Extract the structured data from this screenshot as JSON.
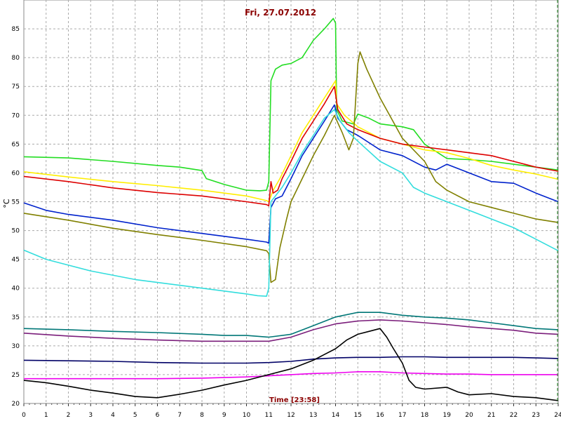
{
  "chart_data": {
    "type": "line",
    "title": "Fri, 27.07.2012",
    "xlabel": "Time [23:58]",
    "ylabel": "°C",
    "xlim": [
      0,
      24
    ],
    "ylim": [
      20,
      90
    ],
    "xticks": [
      0,
      1,
      2,
      3,
      4,
      5,
      6,
      7,
      8,
      9,
      10,
      11,
      12,
      13,
      14,
      15,
      16,
      17,
      18,
      19,
      20,
      21,
      22,
      23,
      24
    ],
    "yticks": [
      20,
      25,
      30,
      35,
      40,
      45,
      50,
      55,
      60,
      65,
      70,
      75,
      80,
      85
    ],
    "grid": true,
    "series": [
      {
        "color": "#22dd22",
        "points": [
          [
            0,
            62.8
          ],
          [
            2,
            62.6
          ],
          [
            4,
            62.0
          ],
          [
            6,
            61.3
          ],
          [
            7,
            61.0
          ],
          [
            8,
            60.4
          ],
          [
            8.2,
            59.0
          ],
          [
            9,
            58.0
          ],
          [
            9.7,
            57.3
          ],
          [
            10,
            57.0
          ],
          [
            10.6,
            56.9
          ],
          [
            10.9,
            57.0
          ],
          [
            11.0,
            58.5
          ],
          [
            11.1,
            76.0
          ],
          [
            11.3,
            78.0
          ],
          [
            11.6,
            78.7
          ],
          [
            12,
            79.0
          ],
          [
            12.5,
            80.0
          ],
          [
            13,
            83.0
          ],
          [
            13.5,
            85.0
          ],
          [
            13.9,
            86.8
          ],
          [
            14.0,
            86.0
          ],
          [
            14.05,
            71.0
          ],
          [
            14.3,
            69.0
          ],
          [
            14.8,
            68.5
          ],
          [
            15,
            70.2
          ],
          [
            15.5,
            69.5
          ],
          [
            16,
            68.5
          ],
          [
            17,
            68.0
          ],
          [
            17.5,
            67.5
          ],
          [
            18,
            65.0
          ],
          [
            19,
            62.5
          ],
          [
            20,
            62.3
          ],
          [
            21,
            62.0
          ],
          [
            22,
            61.5
          ],
          [
            23,
            61.0
          ],
          [
            24,
            60.5
          ]
        ]
      },
      {
        "color": "#ffee00",
        "points": [
          [
            0,
            60.2
          ],
          [
            2,
            59.3
          ],
          [
            4,
            58.5
          ],
          [
            6,
            57.8
          ],
          [
            8,
            57.0
          ],
          [
            10,
            56.0
          ],
          [
            10.9,
            55.2
          ],
          [
            11.0,
            55.0
          ],
          [
            11.2,
            57.0
          ],
          [
            11.5,
            59.0
          ],
          [
            12,
            63.0
          ],
          [
            12.5,
            67.0
          ],
          [
            13,
            70.0
          ],
          [
            13.5,
            73.0
          ],
          [
            14,
            76.0
          ],
          [
            14.05,
            72.0
          ],
          [
            14.4,
            70.0
          ],
          [
            15,
            68.0
          ],
          [
            16,
            66.0
          ],
          [
            17,
            65.0
          ],
          [
            18,
            64.0
          ],
          [
            19,
            63.5
          ],
          [
            20,
            62.5
          ],
          [
            21,
            61.3
          ],
          [
            22,
            60.5
          ],
          [
            23,
            59.8
          ],
          [
            24,
            58.9
          ]
        ]
      },
      {
        "color": "#dd0000",
        "points": [
          [
            0,
            59.4
          ],
          [
            2,
            58.5
          ],
          [
            4,
            57.4
          ],
          [
            6,
            56.6
          ],
          [
            8,
            56.0
          ],
          [
            10,
            55.0
          ],
          [
            10.9,
            54.5
          ],
          [
            11.0,
            54.3
          ],
          [
            11.1,
            58.5
          ],
          [
            11.2,
            56.5
          ],
          [
            11.4,
            57.0
          ],
          [
            11.6,
            59.0
          ],
          [
            12,
            62.0
          ],
          [
            12.5,
            66.0
          ],
          [
            13,
            69.0
          ],
          [
            13.5,
            72.0
          ],
          [
            13.95,
            75.0
          ],
          [
            14.1,
            71.0
          ],
          [
            14.5,
            68.5
          ],
          [
            15,
            67.5
          ],
          [
            16,
            66.0
          ],
          [
            17,
            65.0
          ],
          [
            18,
            64.5
          ],
          [
            19,
            64.0
          ],
          [
            20,
            63.5
          ],
          [
            21,
            63.0
          ],
          [
            22,
            62.0
          ],
          [
            23,
            61.0
          ],
          [
            24,
            60.3
          ]
        ]
      },
      {
        "color": "#0022cc",
        "points": [
          [
            0,
            54.8
          ],
          [
            1,
            53.5
          ],
          [
            2,
            52.8
          ],
          [
            4,
            51.8
          ],
          [
            6,
            50.5
          ],
          [
            8,
            49.5
          ],
          [
            10,
            48.5
          ],
          [
            10.9,
            48.0
          ],
          [
            11.0,
            47.8
          ],
          [
            11.1,
            54.0
          ],
          [
            11.3,
            55.5
          ],
          [
            11.6,
            56.0
          ],
          [
            12,
            59.0
          ],
          [
            12.5,
            63.0
          ],
          [
            13,
            66.0
          ],
          [
            13.5,
            69.0
          ],
          [
            13.95,
            71.8
          ],
          [
            14.1,
            69.5
          ],
          [
            14.5,
            67.5
          ],
          [
            15,
            66.5
          ],
          [
            16,
            64.0
          ],
          [
            17,
            63.0
          ],
          [
            18,
            61.0
          ],
          [
            18.5,
            60.5
          ],
          [
            19,
            61.5
          ],
          [
            20,
            60.0
          ],
          [
            21,
            58.5
          ],
          [
            22,
            58.2
          ],
          [
            23,
            56.5
          ],
          [
            24,
            55.0
          ]
        ]
      },
      {
        "color": "#808000",
        "points": [
          [
            0,
            53.0
          ],
          [
            2,
            51.8
          ],
          [
            4,
            50.4
          ],
          [
            6,
            49.3
          ],
          [
            8,
            48.3
          ],
          [
            10,
            47.2
          ],
          [
            10.9,
            46.5
          ],
          [
            11.0,
            46.0
          ],
          [
            11.1,
            41.0
          ],
          [
            11.3,
            41.5
          ],
          [
            11.5,
            47.0
          ],
          [
            11.8,
            52.0
          ],
          [
            12,
            55.0
          ],
          [
            12.5,
            59.0
          ],
          [
            13,
            63.0
          ],
          [
            13.5,
            66.5
          ],
          [
            13.95,
            70.0
          ],
          [
            14.3,
            67.0
          ],
          [
            14.6,
            64.0
          ],
          [
            14.8,
            66.0
          ],
          [
            15.0,
            79.0
          ],
          [
            15.1,
            81.0
          ],
          [
            15.4,
            78.0
          ],
          [
            16,
            73.0
          ],
          [
            17,
            66.0
          ],
          [
            18,
            62.0
          ],
          [
            18.5,
            58.5
          ],
          [
            19,
            57.0
          ],
          [
            20,
            55.0
          ],
          [
            21,
            54.0
          ],
          [
            22,
            53.0
          ],
          [
            23,
            52.0
          ],
          [
            24,
            51.4
          ]
        ]
      },
      {
        "color": "#33dddd",
        "points": [
          [
            0,
            46.6
          ],
          [
            1,
            45.0
          ],
          [
            2,
            44.0
          ],
          [
            3,
            43.0
          ],
          [
            5,
            41.5
          ],
          [
            7,
            40.5
          ],
          [
            8,
            40.0
          ],
          [
            9,
            39.5
          ],
          [
            10,
            39.0
          ],
          [
            10.5,
            38.7
          ],
          [
            10.9,
            38.6
          ],
          [
            11.0,
            40.0
          ],
          [
            11.1,
            55.0
          ],
          [
            11.3,
            56.0
          ],
          [
            11.6,
            57.5
          ],
          [
            12,
            60.0
          ],
          [
            12.5,
            63.5
          ],
          [
            13,
            66.5
          ],
          [
            13.5,
            69.5
          ],
          [
            13.95,
            71.0
          ],
          [
            14.2,
            69.0
          ],
          [
            14.6,
            67.0
          ],
          [
            15,
            65.5
          ],
          [
            16,
            62.0
          ],
          [
            17,
            60.0
          ],
          [
            17.5,
            57.5
          ],
          [
            18,
            56.5
          ],
          [
            19,
            55.0
          ],
          [
            20,
            53.5
          ],
          [
            21,
            52.0
          ],
          [
            22,
            50.5
          ],
          [
            23,
            48.5
          ],
          [
            24,
            46.5
          ]
        ]
      },
      {
        "color": "#007777",
        "points": [
          [
            0,
            33.0
          ],
          [
            2,
            32.8
          ],
          [
            4,
            32.5
          ],
          [
            6,
            32.3
          ],
          [
            8,
            32.0
          ],
          [
            9,
            31.8
          ],
          [
            10,
            31.8
          ],
          [
            11,
            31.5
          ],
          [
            12,
            32.0
          ],
          [
            13,
            33.5
          ],
          [
            14,
            35.0
          ],
          [
            15,
            35.8
          ],
          [
            16,
            35.8
          ],
          [
            17,
            35.3
          ],
          [
            18,
            35.0
          ],
          [
            19,
            34.8
          ],
          [
            20,
            34.5
          ],
          [
            21,
            34.0
          ],
          [
            22,
            33.5
          ],
          [
            23,
            33.0
          ],
          [
            24,
            32.8
          ]
        ]
      },
      {
        "color": "#7b1e7b",
        "points": [
          [
            0,
            32.2
          ],
          [
            2,
            31.7
          ],
          [
            4,
            31.3
          ],
          [
            6,
            31.0
          ],
          [
            8,
            30.8
          ],
          [
            10,
            30.8
          ],
          [
            11,
            30.8
          ],
          [
            12,
            31.5
          ],
          [
            13,
            32.8
          ],
          [
            14,
            33.8
          ],
          [
            15,
            34.3
          ],
          [
            16,
            34.5
          ],
          [
            17,
            34.3
          ],
          [
            18,
            34.0
          ],
          [
            19,
            33.7
          ],
          [
            20,
            33.3
          ],
          [
            21,
            33.0
          ],
          [
            22,
            32.7
          ],
          [
            23,
            32.2
          ],
          [
            24,
            32.0
          ]
        ]
      },
      {
        "color": "#000066",
        "points": [
          [
            0,
            27.5
          ],
          [
            2,
            27.4
          ],
          [
            4,
            27.3
          ],
          [
            6,
            27.1
          ],
          [
            8,
            27.0
          ],
          [
            10,
            27.0
          ],
          [
            11,
            27.1
          ],
          [
            12,
            27.3
          ],
          [
            13,
            27.7
          ],
          [
            14,
            27.9
          ],
          [
            15,
            28.0
          ],
          [
            16,
            28.0
          ],
          [
            17,
            28.1
          ],
          [
            18,
            28.1
          ],
          [
            19,
            28.0
          ],
          [
            20,
            28.0
          ],
          [
            21,
            28.0
          ],
          [
            22,
            28.0
          ],
          [
            23,
            27.9
          ],
          [
            24,
            27.8
          ]
        ]
      },
      {
        "color": "#ee00ee",
        "points": [
          [
            0,
            24.3
          ],
          [
            2,
            24.3
          ],
          [
            4,
            24.3
          ],
          [
            6,
            24.3
          ],
          [
            8,
            24.4
          ],
          [
            10,
            24.6
          ],
          [
            11,
            24.8
          ],
          [
            12,
            25.0
          ],
          [
            13,
            25.2
          ],
          [
            14,
            25.3
          ],
          [
            15,
            25.5
          ],
          [
            16,
            25.5
          ],
          [
            17,
            25.3
          ],
          [
            18,
            25.2
          ],
          [
            19,
            25.1
          ],
          [
            20,
            25.1
          ],
          [
            21,
            25.0
          ],
          [
            22,
            25.0
          ],
          [
            23,
            25.0
          ],
          [
            24,
            25.0
          ]
        ]
      },
      {
        "color": "#000000",
        "points": [
          [
            0,
            24.0
          ],
          [
            1,
            23.6
          ],
          [
            2,
            23.0
          ],
          [
            3,
            22.3
          ],
          [
            4,
            21.8
          ],
          [
            5,
            21.2
          ],
          [
            6,
            21.0
          ],
          [
            7,
            21.6
          ],
          [
            8,
            22.3
          ],
          [
            9,
            23.2
          ],
          [
            10,
            24.0
          ],
          [
            11,
            25.0
          ],
          [
            12,
            26.0
          ],
          [
            13,
            27.5
          ],
          [
            13.5,
            28.5
          ],
          [
            14,
            29.5
          ],
          [
            14.5,
            31.0
          ],
          [
            15,
            32.0
          ],
          [
            15.5,
            32.5
          ],
          [
            16,
            33.0
          ],
          [
            16.3,
            31.5
          ],
          [
            16.6,
            29.5
          ],
          [
            17,
            27.0
          ],
          [
            17.3,
            24.0
          ],
          [
            17.6,
            22.8
          ],
          [
            18,
            22.5
          ],
          [
            19,
            22.8
          ],
          [
            19.5,
            22.0
          ],
          [
            20,
            21.5
          ],
          [
            21,
            21.7
          ],
          [
            22,
            21.2
          ],
          [
            23,
            21.0
          ],
          [
            24,
            20.5
          ]
        ]
      }
    ]
  }
}
